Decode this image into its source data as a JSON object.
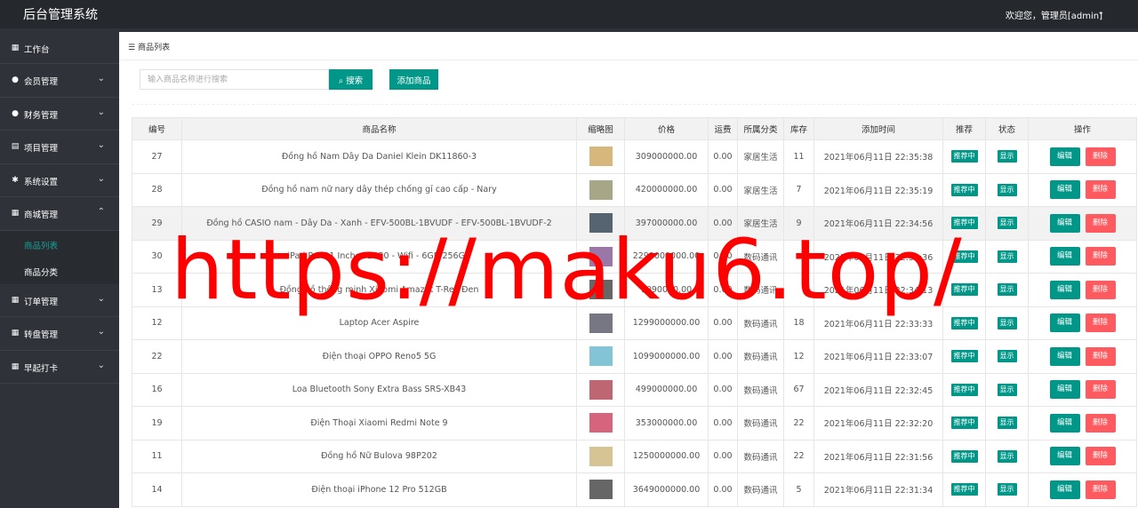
{
  "app": {
    "title": "后台管理系统",
    "welcome": "欢迎您，管理员[admin]"
  },
  "sidebar": {
    "items": [
      {
        "label": "工作台",
        "icon": "dashboard-icon"
      },
      {
        "label": "会员管理",
        "icon": "vip-icon"
      },
      {
        "label": "财务管理",
        "icon": "finance-icon"
      },
      {
        "label": "项目管理",
        "icon": "project-icon"
      },
      {
        "label": "系统设置",
        "icon": "gear-icon"
      },
      {
        "label": "商城管理",
        "icon": "shop-icon"
      },
      {
        "label": "订单管理",
        "icon": "order-icon"
      },
      {
        "label": "转盘管理",
        "icon": "wheel-icon"
      },
      {
        "label": "早起打卡",
        "icon": "checkin-icon"
      }
    ],
    "sub": [
      {
        "label": "商品列表"
      },
      {
        "label": "商品分类"
      }
    ]
  },
  "page": {
    "breadcrumb": "商品列表",
    "search_placeholder": "输入商品名称进行搜索",
    "search_label": "搜索",
    "add_label": "添加商品"
  },
  "table": {
    "headers": [
      "编号",
      "商品名称",
      "缩略图",
      "价格",
      "运费",
      "所属分类",
      "库存",
      "添加时间",
      "推荐",
      "状态",
      "操作"
    ],
    "recommend_label": "推荐中",
    "status_label": "显示",
    "edit_label": "编辑",
    "delete_label": "删除",
    "rows": [
      {
        "id": "27",
        "name": "Đồng hồ Nam Dây Da Daniel Klein DK11860-3",
        "price": "309000000.00",
        "ship": "0.00",
        "cat": "家居生活",
        "stock": "11",
        "time": "2021年06月11日 22:35:38",
        "color": "#c8a050"
      },
      {
        "id": "28",
        "name": "Đồng hồ nam nữ nary dây thép chống gỉ cao cấp - Nary",
        "price": "420000000.00",
        "ship": "0.00",
        "cat": "家居生活",
        "stock": "7",
        "time": "2021年06月11日 22:35:19",
        "color": "#8a8a60"
      },
      {
        "id": "29",
        "name": "Đồng hồ CASIO nam - Dây Da - Xanh - EFV-500BL-1BVUDF - EFV-500BL-1BVUDF-2",
        "price": "397000000.00",
        "ship": "0.00",
        "cat": "家居生活",
        "stock": "9",
        "time": "2021年06月11日 22:34:56",
        "color": "#223344"
      },
      {
        "id": "30",
        "name": "iPad Pro 11 Inches 2020 - Wifi - 6GB/256GB",
        "price": "2299000000.00",
        "ship": "0.00",
        "cat": "数码通讯",
        "stock": "",
        "time": "2021年06月11日 22:34:36",
        "color": "#7a4a8a"
      },
      {
        "id": "13",
        "name": "Đồng hồ thông minh Xiaomi Amazfit T-Rex Đen",
        "price": "1090000.00",
        "ship": "0.00",
        "cat": "数码通讯",
        "stock": "",
        "time": "2021年06月11日 22:34:13",
        "color": "#333333"
      },
      {
        "id": "12",
        "name": "Laptop Acer Aspire",
        "price": "1299000000.00",
        "ship": "0.00",
        "cat": "数码通讯",
        "stock": "18",
        "time": "2021年06月11日 22:33:33",
        "color": "#4a4a5a"
      },
      {
        "id": "22",
        "name": "Điện thoại OPPO Reno5 5G",
        "price": "1099000000.00",
        "ship": "0.00",
        "cat": "数码通讯",
        "stock": "12",
        "time": "2021年06月11日 22:33:07",
        "color": "#5ab0c8"
      },
      {
        "id": "16",
        "name": "Loa Bluetooth Sony Extra Bass SRS-XB43",
        "price": "499000000.00",
        "ship": "0.00",
        "cat": "数码通讯",
        "stock": "67",
        "time": "2021年06月11日 22:32:45",
        "color": "#aa3344"
      },
      {
        "id": "19",
        "name": "Điện Thoại Xiaomi Redmi Note 9",
        "price": "353000000.00",
        "ship": "0.00",
        "cat": "数码通讯",
        "stock": "22",
        "time": "2021年06月11日 22:32:20",
        "color": "#c83050"
      },
      {
        "id": "11",
        "name": "Đồng hồ Nữ Bulova 98P202",
        "price": "1250000000.00",
        "ship": "0.00",
        "cat": "数码通讯",
        "stock": "22",
        "time": "2021年06月11日 22:31:56",
        "color": "#c8b070"
      },
      {
        "id": "14",
        "name": "Điện thoại iPhone 12 Pro 512GB",
        "price": "3649000000.00",
        "ship": "0.00",
        "cat": "数码通讯",
        "stock": "5",
        "time": "2021年06月11日 22:31:34",
        "color": "#333333"
      }
    ]
  },
  "watermark": "https://maku6.top/"
}
